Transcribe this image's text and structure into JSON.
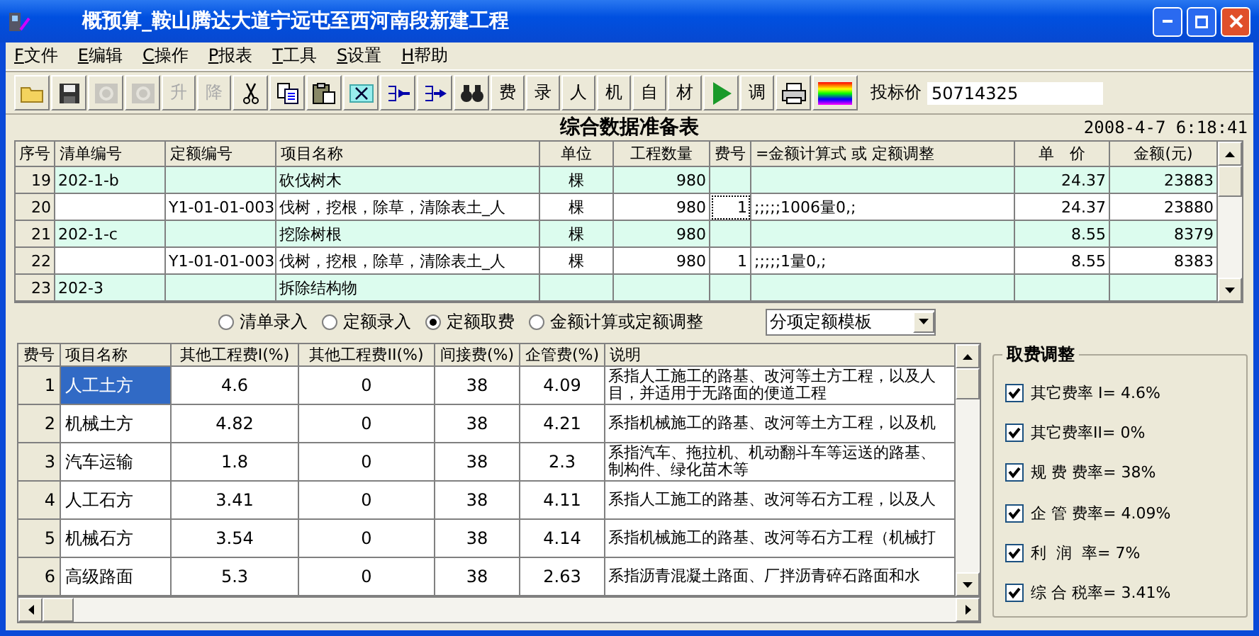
{
  "window": {
    "title": "概预算_鞍山腾达大道宁远屯至西河南段新建工程"
  },
  "menu": [
    {
      "key": "F",
      "label": "文件"
    },
    {
      "key": "E",
      "label": "编辑"
    },
    {
      "key": "C",
      "label": "操作"
    },
    {
      "key": "P",
      "label": "报表"
    },
    {
      "key": "T",
      "label": "工具"
    },
    {
      "key": "S",
      "label": "设置"
    },
    {
      "key": "H",
      "label": "帮助"
    }
  ],
  "toolbar": {
    "items": [
      {
        "kind": "icon",
        "disabled": false
      },
      {
        "kind": "icon",
        "disabled": false
      },
      {
        "kind": "icon",
        "disabled": true
      },
      {
        "kind": "icon",
        "disabled": true
      },
      {
        "kind": "text",
        "label": "升",
        "disabled": true
      },
      {
        "kind": "text",
        "label": "降",
        "disabled": true
      },
      {
        "kind": "icon",
        "disabled": false
      },
      {
        "kind": "icon",
        "disabled": false
      },
      {
        "kind": "icon",
        "disabled": false
      },
      {
        "kind": "icon",
        "disabled": false
      },
      {
        "kind": "icon",
        "disabled": false
      },
      {
        "kind": "icon",
        "disabled": false
      },
      {
        "kind": "icon",
        "disabled": false
      },
      {
        "kind": "text",
        "label": "费",
        "disabled": false
      },
      {
        "kind": "text",
        "label": "录",
        "disabled": false
      },
      {
        "kind": "text",
        "label": "人",
        "disabled": false
      },
      {
        "kind": "text",
        "label": "机",
        "disabled": false
      },
      {
        "kind": "text",
        "label": "自",
        "disabled": false
      },
      {
        "kind": "text",
        "label": "材",
        "disabled": false
      },
      {
        "kind": "icon",
        "disabled": false
      },
      {
        "kind": "text",
        "label": "调",
        "disabled": false
      },
      {
        "kind": "icon",
        "disabled": false
      },
      {
        "kind": "icon",
        "disabled": false
      }
    ],
    "bid_label": "投标价",
    "bid_value": "50714325"
  },
  "sheet": {
    "title": "综合数据准备表",
    "timestamp": "2008-4-7 6:18:41"
  },
  "top_table": {
    "columns": [
      "序号",
      "清单编号",
      "定额编号",
      "项目名称",
      "单位",
      "工程数量",
      "费号",
      "=金额计算式 或 定额调整",
      "单　价",
      "金额(元)"
    ],
    "rows": [
      {
        "kind": "bill",
        "no": "19",
        "bill_code": "202-1-b",
        "quota_code": "",
        "name": "砍伐树木",
        "unit": "棵",
        "quantity": "980",
        "fee_no": "",
        "formula": "",
        "unit_price": "24.37",
        "amount": "23883",
        "fee_focused": false
      },
      {
        "kind": "quota",
        "no": "20",
        "bill_code": "",
        "quota_code": "Y1-01-01-003",
        "name": "伐树，挖根，除草，清除表土_人",
        "unit": "棵",
        "quantity": "980",
        "fee_no": "1",
        "formula": ";;;;;1006量0,;",
        "unit_price": "24.37",
        "amount": "23880",
        "fee_focused": true
      },
      {
        "kind": "bill",
        "no": "21",
        "bill_code": "202-1-c",
        "quota_code": "",
        "name": "挖除树根",
        "unit": "棵",
        "quantity": "980",
        "fee_no": "",
        "formula": "",
        "unit_price": "8.55",
        "amount": "8379",
        "fee_focused": false
      },
      {
        "kind": "quota",
        "no": "22",
        "bill_code": "",
        "quota_code": "Y1-01-01-003",
        "name": "伐树，挖根，除草，清除表土_人",
        "unit": "棵",
        "quantity": "980",
        "fee_no": "1",
        "formula": ";;;;;1量0,;",
        "unit_price": "8.55",
        "amount": "8383",
        "fee_focused": false
      },
      {
        "kind": "bill",
        "no": "23",
        "bill_code": "202-3",
        "quota_code": "",
        "name": "拆除结构物",
        "unit": "",
        "quantity": "",
        "fee_no": "",
        "formula": "",
        "unit_price": "",
        "amount": "",
        "fee_focused": false
      }
    ]
  },
  "modes": [
    {
      "label": "清单录入",
      "selected": false
    },
    {
      "label": "定额录入",
      "selected": false
    },
    {
      "label": "定额取费",
      "selected": true
    },
    {
      "label": "金额计算或定额调整",
      "selected": false
    }
  ],
  "template_select": {
    "value": "分项定额模板"
  },
  "fee_table": {
    "columns": [
      "费号",
      "项目名称",
      "其他工程费I(%)",
      "其他工程费II(%)",
      "间接费(%)",
      "企管费(%)",
      "说明"
    ],
    "rows": [
      {
        "no": "1",
        "name": "人工土方",
        "other1": "4.6",
        "other2": "0",
        "indirect": "38",
        "mgmt": "4.09",
        "note": [
          "系指人工施工的路基、改河等土方工程，以及人",
          "目，并适用于无路面的便道工程"
        ],
        "selected": true
      },
      {
        "no": "2",
        "name": "机械土方",
        "other1": "4.82",
        "other2": "0",
        "indirect": "38",
        "mgmt": "4.21",
        "note": [
          "系指机械施工的路基、改河等土方工程，以及机"
        ],
        "selected": false
      },
      {
        "no": "3",
        "name": "汽车运输",
        "other1": "1.8",
        "other2": "0",
        "indirect": "38",
        "mgmt": "2.3",
        "note": [
          "系指汽车、拖拉机、机动翻斗车等运送的路基、",
          "制构件、绿化苗木等"
        ],
        "selected": false
      },
      {
        "no": "4",
        "name": "人工石方",
        "other1": "3.41",
        "other2": "0",
        "indirect": "38",
        "mgmt": "4.11",
        "note": [
          "系指人工施工的路基、改河等石方工程，以及人"
        ],
        "selected": false
      },
      {
        "no": "5",
        "name": "机械石方",
        "other1": "3.54",
        "other2": "0",
        "indirect": "38",
        "mgmt": "4.14",
        "note": [
          "系指机械施工的路基、改河等石方工程（机械打"
        ],
        "selected": false
      },
      {
        "no": "6",
        "name": "高级路面",
        "other1": "5.3",
        "other2": "0",
        "indirect": "38",
        "mgmt": "2.63",
        "note": [
          "系指沥青混凝土路面、厂拌沥青碎石路面和水"
        ],
        "selected": false
      }
    ]
  },
  "fee_adjust": {
    "title": "取费调整",
    "items": [
      {
        "label": "其它费率 I= 4.6%",
        "checked": true
      },
      {
        "label": "其它费率II= 0%",
        "checked": true
      },
      {
        "label": "规 费 费率= 38%",
        "checked": true
      },
      {
        "label": "企 管 费率= 4.09%",
        "checked": true
      },
      {
        "label": "利  润  率= 7%",
        "checked": true
      },
      {
        "label": "综 合 税率= 3.41%",
        "checked": true
      }
    ]
  }
}
